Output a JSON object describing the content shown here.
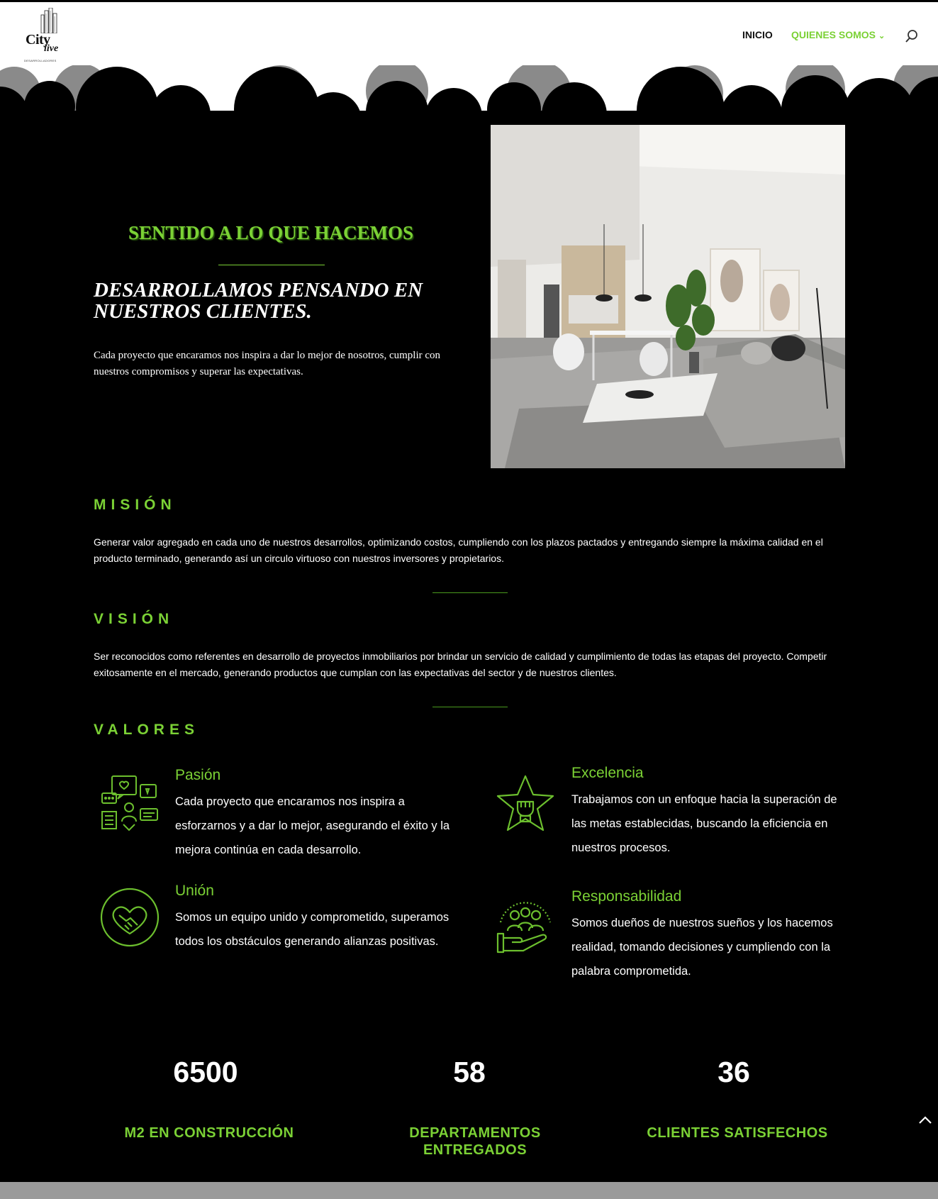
{
  "header": {
    "logo_top": "City",
    "logo_script": "live",
    "logo_sub": "DESARROLLADORES",
    "nav": [
      {
        "label": "INICIO",
        "active": false
      },
      {
        "label": "QUIENES SOMOS",
        "active": true
      }
    ],
    "search_icon": "search-icon"
  },
  "hero": {
    "title": "SENTIDO A LO QUE HACEMOS",
    "subtitle": "DESARROLLAMOS PENSANDO EN NUESTROS CLIENTES.",
    "text": "Cada proyecto que encaramos nos inspira a dar lo mejor de nosotros, cumplir con nuestros compromisos y superar las expectativas."
  },
  "mision": {
    "heading": "MISIÓN",
    "text": "Generar valor agregado en cada uno de nuestros desarrollos, optimizando costos, cumpliendo con los plazos pactados y entregando siempre la máxima calidad en el producto terminado, generando así un circulo virtuoso con nuestros inversores y propietarios."
  },
  "vision": {
    "heading": "VISIÓN",
    "text": "Ser reconocidos como referentes en desarrollo de proyectos inmobiliarios por brindar un servicio de calidad y cumplimiento de todas las etapas del proyecto. Competir exitosamente en el mercado, generando productos que cumplan con las expectativas del sector y de nuestros clientes."
  },
  "valores": {
    "heading": "VALORES",
    "items": [
      {
        "title": "Pasión",
        "text": "Cada proyecto que encaramos nos inspira a esforzarnos y a dar lo mejor, asegurando el éxito y la mejora continúa en cada desarrollo.",
        "icon": "chat-bubbles-icon"
      },
      {
        "title": "Excelencia",
        "text": "Trabajamos con un enfoque hacia la superación de las metas establecidas, buscando la eficiencia en nuestros procesos.",
        "icon": "star-fist-icon"
      },
      {
        "title": "Unión",
        "text": "Somos un equipo unido y comprometido, superamos todos los obstáculos generando alianzas positivas.",
        "icon": "heart-handshake-icon"
      },
      {
        "title": "Responsabilidad",
        "text": "Somos dueños de nuestros sueños y los hacemos realidad, tomando decisiones y cumpliendo con la palabra comprometida.",
        "icon": "team-hand-icon"
      }
    ]
  },
  "stats": [
    {
      "number": "6500",
      "label": "M2 EN CONSTRUCCIÓN"
    },
    {
      "number": "58",
      "label": "DEPARTAMENTOS ENTREGADOS"
    },
    {
      "number": "36",
      "label": "CLIENTES SATISFECHOS"
    }
  ],
  "colors": {
    "accent": "#7bd135",
    "background": "#000000",
    "header": "#ffffff"
  }
}
